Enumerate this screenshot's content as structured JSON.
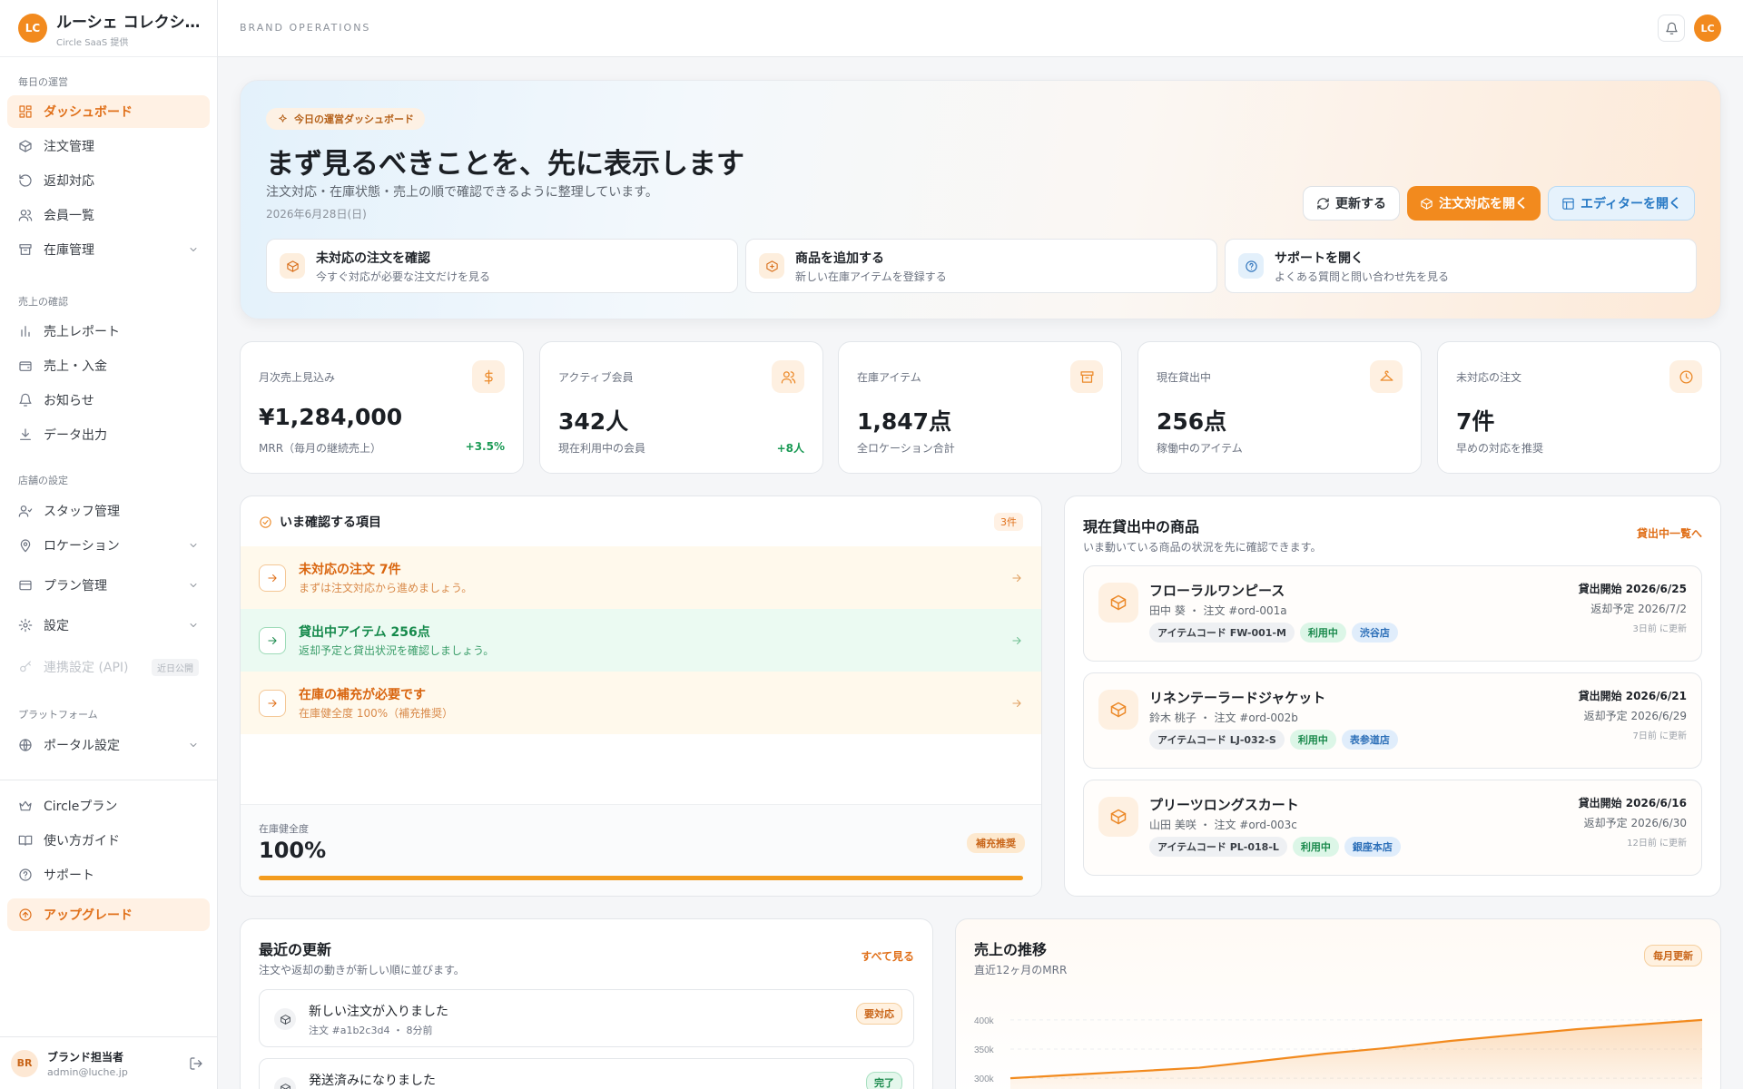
{
  "brand": {
    "logo": "LC",
    "name": "ルーシェ コレクション",
    "sub": "Circle SaaS 提供"
  },
  "nav": {
    "section_daily": "毎日の運営",
    "section_sales": "売上の確認",
    "section_store": "店舗の設定",
    "section_platform": "プラットフォーム",
    "items": [
      {
        "label": "ダッシュボード",
        "icon": "dashboard-icon"
      },
      {
        "label": "注文管理",
        "icon": "box-icon"
      },
      {
        "label": "返却対応",
        "icon": "return-icon"
      },
      {
        "label": "会員一覧",
        "icon": "users-icon"
      },
      {
        "label": "在庫管理",
        "icon": "archive-icon"
      },
      {
        "label": "売上レポート",
        "icon": "bar-chart-icon"
      },
      {
        "label": "売上・入金",
        "icon": "wallet-icon"
      },
      {
        "label": "お知らせ",
        "icon": "bell-icon"
      },
      {
        "label": "データ出力",
        "icon": "download-icon"
      },
      {
        "label": "スタッフ管理",
        "icon": "staff-icon"
      },
      {
        "label": "ロケーション",
        "icon": "map-pin-icon"
      },
      {
        "label": "プラン管理",
        "icon": "credit-card-icon"
      },
      {
        "label": "設定",
        "icon": "gear-icon"
      },
      {
        "label": "連携設定 (API)",
        "icon": "key-icon",
        "badge": "近日公開"
      },
      {
        "label": "ポータル設定",
        "icon": "globe-icon"
      },
      {
        "label": "Circleプラン",
        "icon": "crown-icon"
      },
      {
        "label": "使い方ガイド",
        "icon": "book-icon"
      },
      {
        "label": "サポート",
        "icon": "help-icon"
      },
      {
        "label": "アップグレード",
        "icon": "upgrade-icon"
      }
    ]
  },
  "user": {
    "initials": "BR",
    "name": "ブランド担当者",
    "email": "admin@luche.jp"
  },
  "topbar": {
    "label": "BRAND OPERATIONS",
    "avatar": "LC"
  },
  "hero": {
    "pill": "今日の運営ダッシュボード",
    "title": "まず見るべきことを、先に表示します",
    "desc": "注文対応・在庫状態・売上の順で確認できるように整理しています。",
    "date": "2026年6月28日(日)",
    "btn_refresh": "更新する",
    "btn_orders": "注文対応を開く",
    "btn_editor": "エディターを開く",
    "quick": [
      {
        "title": "未対応の注文を確認",
        "sub": "今すぐ対応が必要な注文だけを見る"
      },
      {
        "title": "商品を追加する",
        "sub": "新しい在庫アイテムを登録する"
      },
      {
        "title": "サポートを開く",
        "sub": "よくある質問と問い合わせ先を見る"
      }
    ]
  },
  "stats": [
    {
      "label": "月次売上見込み",
      "value": "¥1,284,000",
      "sub": "MRR（毎月の継続売上）",
      "delta": "+3.5%",
      "icon": "dollar-icon"
    },
    {
      "label": "アクティブ会員",
      "value": "342人",
      "sub": "現在利用中の会員",
      "delta": "+8人",
      "icon": "users-icon"
    },
    {
      "label": "在庫アイテム",
      "value": "1,847点",
      "sub": "全ロケーション合計",
      "delta": "",
      "icon": "archive-icon"
    },
    {
      "label": "現在貸出中",
      "value": "256点",
      "sub": "稼働中のアイテム",
      "delta": "",
      "icon": "hanger-icon"
    },
    {
      "label": "未対応の注文",
      "value": "7件",
      "sub": "早めの対応を推奨",
      "delta": "",
      "icon": "clock-icon"
    }
  ],
  "checks": {
    "title": "いま確認する項目",
    "count": "3件",
    "rows": [
      {
        "title": "未対応の注文 7件",
        "sub": "まずは注文対応から進めましょう。"
      },
      {
        "title": "貸出中アイテム 256点",
        "sub": "返却予定と貸出状況を確認しましょう。"
      },
      {
        "title": "在庫の補充が必要です",
        "sub": "在庫健全度 100%（補充推奨）"
      }
    ],
    "health_label": "在庫健全度",
    "health_value": "100%",
    "health_badge": "補充推奨",
    "health_fraction": 1.0
  },
  "loans": {
    "title": "現在貸出中の商品",
    "sub": "いま動いている商品の状況を先に確認できます。",
    "link": "貸出中一覧へ",
    "items": [
      {
        "name": "フローラルワンピース",
        "meta": "田中 葵 ・ 注文 #ord-001a",
        "code": "アイテムコード FW-001-M",
        "status": "利用中",
        "store": "渋谷店",
        "start": "貸出開始 2026/6/25",
        "due": "返却予定 2026/7/2",
        "updated": "3日前 に更新"
      },
      {
        "name": "リネンテーラードジャケット",
        "meta": "鈴木 桃子 ・ 注文 #ord-002b",
        "code": "アイテムコード LJ-032-S",
        "status": "利用中",
        "store": "表参道店",
        "start": "貸出開始 2026/6/21",
        "due": "返却予定 2026/6/29",
        "updated": "7日前 に更新"
      },
      {
        "name": "プリーツロングスカート",
        "meta": "山田 美咲 ・ 注文 #ord-003c",
        "code": "アイテムコード PL-018-L",
        "status": "利用中",
        "store": "銀座本店",
        "start": "貸出開始 2026/6/16",
        "due": "返却予定 2026/6/30",
        "updated": "12日前 に更新"
      }
    ]
  },
  "updates": {
    "title": "最近の更新",
    "sub": "注文や返却の動きが新しい順に並びます。",
    "link": "すべて見る",
    "items": [
      {
        "title": "新しい注文が入りました",
        "meta": "注文 #a1b2c3d4 ・ 8分前",
        "badge": "要対応"
      },
      {
        "title": "発送済みになりました",
        "meta": "",
        "badge": "完了"
      }
    ]
  },
  "sales": {
    "title": "売上の推移",
    "sub": "直近12ヶ月のMRR",
    "badge": "毎月更新"
  },
  "chart_data": {
    "type": "area",
    "title": "売上の推移",
    "subtitle": "直近12ヶ月のMRR",
    "yticks": [
      "400k",
      "350k",
      "300k"
    ],
    "ylim": [
      280,
      420
    ],
    "x": [
      1,
      2,
      3,
      4,
      5,
      6,
      7,
      8,
      9,
      10,
      11,
      12
    ],
    "values": [
      300,
      306,
      312,
      318,
      330,
      342,
      352,
      364,
      374,
      384,
      392,
      400
    ],
    "color": "#f28a1e"
  }
}
